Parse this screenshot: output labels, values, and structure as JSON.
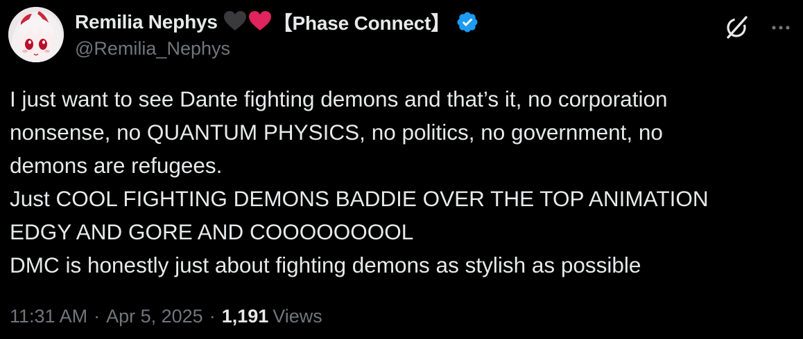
{
  "author": {
    "display_name": "Remilia Nephys",
    "name_emojis": [
      "black-heart",
      "red-heart"
    ],
    "name_suffix": "【Phase Connect】",
    "handle": "@Remilia_Nephys",
    "verified": true,
    "verified_color": "#1d9bf0"
  },
  "tweet": {
    "lines": [
      "I just want to see Dante fighting demons and that’s it, no corporation",
      "nonsense, no QUANTUM PHYSICS, no politics, no government, no",
      "demons are refugees.",
      "Just COOL FIGHTING DEMONS BADDIE OVER THE TOP ANIMATION",
      "EDGY AND GORE AND COOOOOOOOL",
      "DMC is honestly just about fighting demons as stylish as possible"
    ]
  },
  "meta": {
    "time": "11:31 AM",
    "separator": "·",
    "date": "Apr 5, 2025",
    "views_count": "1,191",
    "views_label": "Views"
  },
  "icons": {
    "grok": "grok-icon",
    "more": "more-horizontal-icon"
  },
  "colors": {
    "background": "#000000",
    "text_primary": "#e7e9ea",
    "text_secondary": "#71767b",
    "heart_red": "#e0245e",
    "heart_black": "#3a3a3c"
  }
}
